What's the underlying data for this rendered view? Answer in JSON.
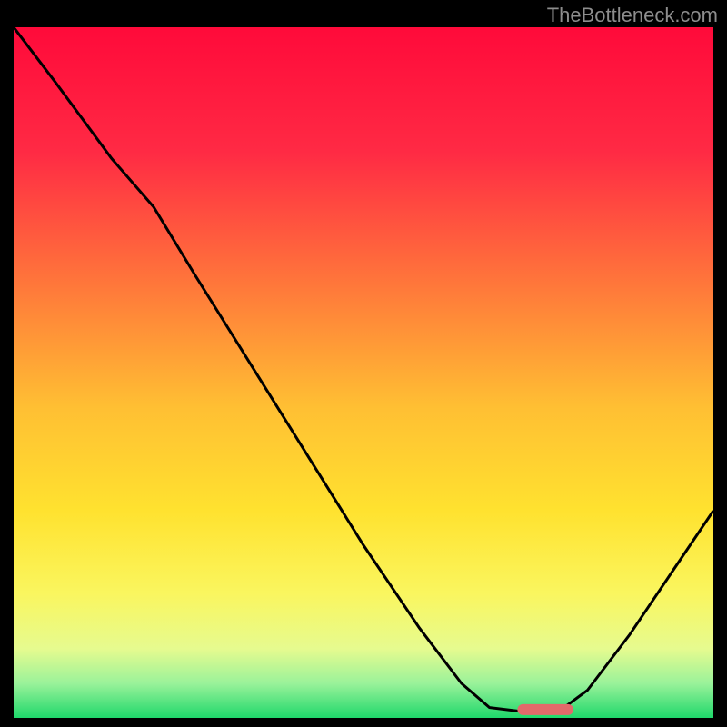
{
  "watermark": "TheBottleneck.com",
  "chart_data": {
    "type": "line",
    "title": "",
    "xlabel": "",
    "ylabel": "",
    "ylim": [
      0,
      100
    ],
    "xlim": [
      0,
      100
    ],
    "gradient_stops": [
      {
        "offset": 0,
        "color": "#ff0a3a"
      },
      {
        "offset": 18,
        "color": "#ff2a44"
      },
      {
        "offset": 38,
        "color": "#ff7a3a"
      },
      {
        "offset": 55,
        "color": "#ffbf33"
      },
      {
        "offset": 70,
        "color": "#ffe22f"
      },
      {
        "offset": 82,
        "color": "#faf65f"
      },
      {
        "offset": 90,
        "color": "#e6fb8f"
      },
      {
        "offset": 95,
        "color": "#9af29a"
      },
      {
        "offset": 100,
        "color": "#1fd86b"
      }
    ],
    "curve_points": [
      {
        "x": 0,
        "y": 100
      },
      {
        "x": 6,
        "y": 92
      },
      {
        "x": 14,
        "y": 81
      },
      {
        "x": 20,
        "y": 74
      },
      {
        "x": 26,
        "y": 64
      },
      {
        "x": 34,
        "y": 51
      },
      {
        "x": 42,
        "y": 38
      },
      {
        "x": 50,
        "y": 25
      },
      {
        "x": 58,
        "y": 13
      },
      {
        "x": 64,
        "y": 5
      },
      {
        "x": 68,
        "y": 1.5
      },
      {
        "x": 72,
        "y": 1
      },
      {
        "x": 78,
        "y": 1
      },
      {
        "x": 82,
        "y": 4
      },
      {
        "x": 88,
        "y": 12
      },
      {
        "x": 94,
        "y": 21
      },
      {
        "x": 100,
        "y": 30
      }
    ],
    "marker": {
      "x_start": 72,
      "x_end": 80,
      "y": 1.2,
      "color": "#e26a6a"
    }
  }
}
